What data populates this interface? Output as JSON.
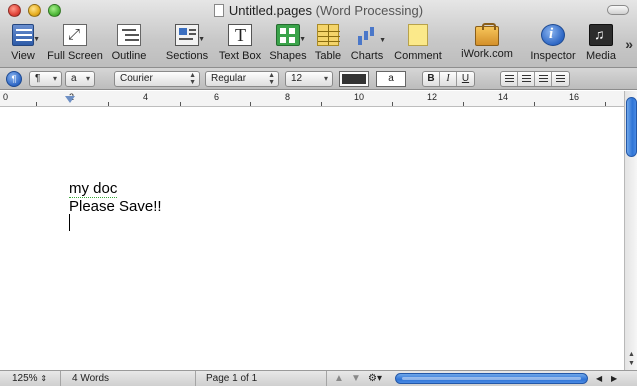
{
  "window": {
    "title": "Untitled.pages",
    "subtitle": "(Word Processing)"
  },
  "toolbar": {
    "items": [
      {
        "label": "View",
        "icon": "view-icon"
      },
      {
        "label": "Full Screen",
        "icon": "full-screen-icon"
      },
      {
        "label": "Outline",
        "icon": "outline-icon"
      },
      {
        "label": "Sections",
        "icon": "sections-icon"
      },
      {
        "label": "Text Box",
        "icon": "text-box-icon"
      },
      {
        "label": "Shapes",
        "icon": "shapes-icon"
      },
      {
        "label": "Table",
        "icon": "table-icon"
      },
      {
        "label": "Charts",
        "icon": "charts-icon"
      },
      {
        "label": "Comment",
        "icon": "comment-icon"
      },
      {
        "label": "iWork.com",
        "icon": "iwork-icon"
      },
      {
        "label": "Inspector",
        "icon": "inspector-icon"
      },
      {
        "label": "Media",
        "icon": "media-icon"
      }
    ],
    "overflow": "»"
  },
  "formatbar": {
    "paragraph_style": "¶",
    "character_style": "a",
    "font_family": "Courier",
    "font_typeface": "Regular",
    "font_size": "12",
    "text_color": "#333333",
    "bg_label": "a",
    "bold": "B",
    "italic": "I",
    "underline": "U"
  },
  "ruler": {
    "labels": [
      "0",
      "2",
      "4",
      "6",
      "8",
      "10",
      "12",
      "14",
      "16"
    ]
  },
  "document": {
    "lines": [
      "my doc",
      "Please Save!!"
    ]
  },
  "status": {
    "zoom": "125%",
    "word_count": "4 Words",
    "page": "Page 1 of 1"
  }
}
